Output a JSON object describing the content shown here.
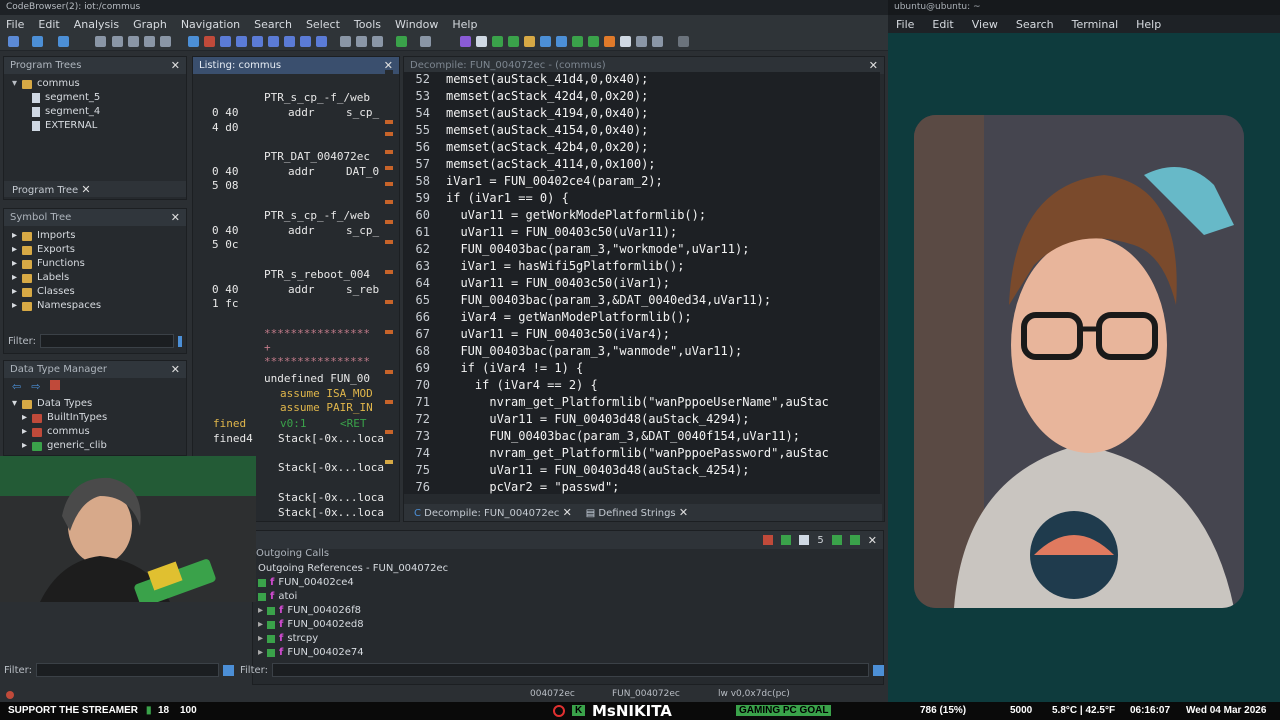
{
  "window_title": "CodeBrowser(2): iot:/commus",
  "menu": [
    "File",
    "Edit",
    "Analysis",
    "Graph",
    "Navigation",
    "Search",
    "Select",
    "Tools",
    "Window",
    "Help"
  ],
  "program_trees": {
    "title": "Program Trees",
    "root": "commus",
    "items": [
      "segment_5",
      "segment_4",
      "EXTERNAL"
    ],
    "tab": "Program Tree"
  },
  "symbol_tree": {
    "title": "Symbol Tree",
    "items": [
      "Imports",
      "Exports",
      "Functions",
      "Labels",
      "Classes",
      "Namespaces"
    ],
    "filter_label": "Filter:"
  },
  "data_type_manager": {
    "title": "Data Type Manager",
    "items": [
      "Data Types",
      "BuiltInTypes",
      "commus",
      "generic_clib"
    ]
  },
  "listing": {
    "title": "Listing:  commus",
    "lines": [
      {
        "addr": "0 40",
        "a2": "4 d0",
        "label": "PTR_s_cp_-f_/web",
        "op": "addr",
        "ref": "s_cp_"
      },
      {
        "addr": "0 40",
        "a2": "5 08",
        "label": "PTR_DAT_004072ec",
        "op": "addr",
        "ref": "DAT_0"
      },
      {
        "addr": "0 40",
        "a2": "5 0c",
        "label": "PTR_s_cp_-f_/web",
        "op": "addr",
        "ref": "s_cp_"
      },
      {
        "addr": "0 40",
        "a2": "1 fc",
        "label": "PTR_s_reboot_004",
        "op": "addr",
        "ref": "s_reb"
      }
    ],
    "stars": "****************",
    "plus": "+",
    "undefined": "undefined FUN_00",
    "assume1": "assume ISA_MOD",
    "assume2": "assume PAIR_IN",
    "v0": "v0:1",
    "ret": "<RET",
    "fined": "fined",
    "fined4": "fined4",
    "stack": [
      "Stack[-0x...loca",
      "Stack[-0x...loca",
      "Stack[-0x...loca",
      "Stack[-0x...loca"
    ]
  },
  "decompile": {
    "title": "Decompile: FUN_004072ec - (commus)",
    "tab1": "Decompile: FUN_004072ec",
    "tab2": "Defined Strings",
    "lines": [
      {
        "n": "52",
        "t": "memset(auStack_41d4,0,0x40);"
      },
      {
        "n": "53",
        "t": "memset(acStack_42d4,0,0x20);"
      },
      {
        "n": "54",
        "t": "memset(auStack_4194,0,0x40);"
      },
      {
        "n": "55",
        "t": "memset(auStack_4154,0,0x40);"
      },
      {
        "n": "56",
        "t": "memset(acStack_42b4,0,0x20);"
      },
      {
        "n": "57",
        "t": "memset(acStack_4114,0,0x100);"
      },
      {
        "n": "58",
        "t": "iVar1 = FUN_00402ce4(param_2);"
      },
      {
        "n": "59",
        "t": "if (iVar1 == 0) {"
      },
      {
        "n": "60",
        "t": "  uVar11 = getWorkModePlatformlib();"
      },
      {
        "n": "61",
        "t": "  uVar11 = FUN_00403c50(uVar11);"
      },
      {
        "n": "62",
        "t": "  FUN_00403bac(param_3,\"workmode\",uVar11);"
      },
      {
        "n": "63",
        "t": "  iVar1 = hasWifi5gPlatformlib();"
      },
      {
        "n": "64",
        "t": "  uVar11 = FUN_00403c50(iVar1);"
      },
      {
        "n": "65",
        "t": "  FUN_00403bac(param_3,&DAT_0040ed34,uVar11);"
      },
      {
        "n": "66",
        "t": "  iVar4 = getWanModePlatformlib();"
      },
      {
        "n": "67",
        "t": "  uVar11 = FUN_00403c50(iVar4);"
      },
      {
        "n": "68",
        "t": "  FUN_00403bac(param_3,\"wanmode\",uVar11);"
      },
      {
        "n": "69",
        "t": "  if (iVar4 != 1) {"
      },
      {
        "n": "70",
        "t": "    if (iVar4 == 2) {"
      },
      {
        "n": "71",
        "t": "      nvram_get_Platformlib(\"wanPppoeUserName\",auStac"
      },
      {
        "n": "72",
        "t": "      uVar11 = FUN_00403d48(auStack_4294);"
      },
      {
        "n": "73",
        "t": "      FUN_00403bac(param_3,&DAT_0040f154,uVar11);"
      },
      {
        "n": "74",
        "t": "      nvram_get_Platformlib(\"wanPppoePassword\",auStac"
      },
      {
        "n": "75",
        "t": "      uVar11 = FUN_00403d48(auStack_4254);"
      },
      {
        "n": "76",
        "t": "      pcVar2 = \"passwd\";"
      }
    ]
  },
  "calls": {
    "title": "Outgoing Calls",
    "header": "Outgoing References - FUN_004072ec",
    "items": [
      "FUN_00402ce4",
      "atoi",
      "FUN_004026f8",
      "FUN_00402ed8",
      "strcpy",
      "FUN_00402e74"
    ],
    "count": "5"
  },
  "status": {
    "addr1": "004072ec",
    "addr2": "FUN_004072ec",
    "instr": "lw v0,0x7dc(pc)"
  },
  "terminal": {
    "title": "ubuntu@ubuntu: ~",
    "menu": [
      "File",
      "Edit",
      "View",
      "Search",
      "Terminal",
      "Help"
    ]
  },
  "overlay": {
    "support": "SUPPORT THE STREAMER",
    "count": "18",
    "total": "100",
    "name": "MsNIKITA",
    "goal": "GAMING PC GOAL",
    "pct": "786 (15%)",
    "goal_total": "5000",
    "weather": "5.8°C | 42.5°F",
    "time": "06:16:07",
    "date": "Wed 04 Mar 2026"
  },
  "colors": {
    "accent": "#3a4f6e",
    "string": "#cfd2d6",
    "param": "#c46fd1",
    "terminal_bg": "#0e3b3d"
  }
}
